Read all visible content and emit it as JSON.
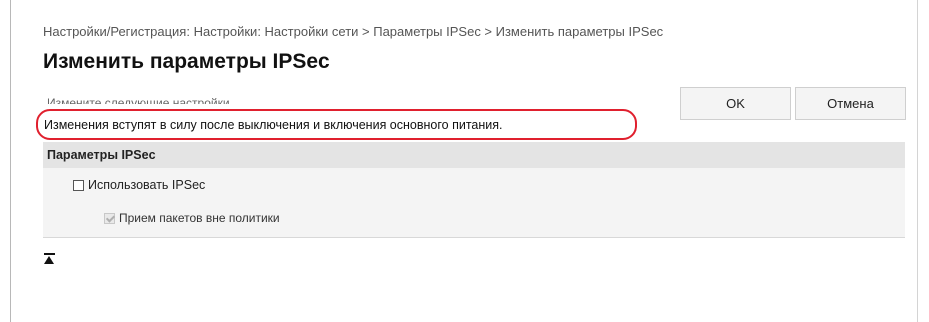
{
  "breadcrumb": "Настройки/Регистрация: Настройки: Настройки сети > Параметры IPSec > Изменить параметры IPSec",
  "page_title": "Изменить параметры IPSec",
  "instruction": "Измените следующие настройки.",
  "buttons": {
    "ok": "OK",
    "cancel": "Отмена"
  },
  "notice": "Изменения вступят в силу после выключения и включения основного питания.",
  "section": {
    "title": "Параметры IPSec",
    "options": [
      {
        "label": "Использовать IPSec",
        "checked": false,
        "disabled": false
      },
      {
        "label": "Прием пакетов вне политики",
        "checked": true,
        "disabled": true
      }
    ]
  },
  "colors": {
    "highlight_border": "#e0202e",
    "section_header_bg": "#e4e4e4",
    "section_body_bg": "#f4f4f4"
  },
  "icons": {
    "to_top": "scroll-to-top-icon"
  }
}
